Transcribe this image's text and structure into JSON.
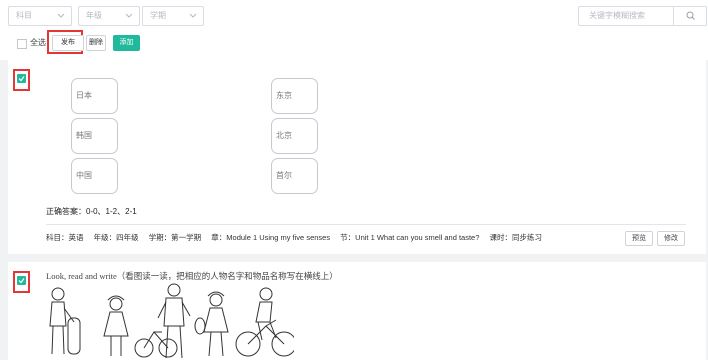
{
  "filters": {
    "subject": "科目",
    "grade": "年级",
    "term": "学期",
    "search_placeholder": "关键字模糊搜索"
  },
  "toolbar": {
    "select_all": "全选",
    "publish": "发布",
    "delete": "删除",
    "add": "添加"
  },
  "question1": {
    "left_options": [
      "日本",
      "韩国",
      "中国"
    ],
    "right_options": [
      "东京",
      "北京",
      "首尔"
    ],
    "answer": "正确答案：0-0、1-2、2-1",
    "meta": {
      "subject": "科目：英语",
      "grade": "年级：四年级",
      "term": "学期：第一学期",
      "chapter": "章：Module 1   Using my five senses",
      "section": "节：Unit 1   What can you smell and taste?",
      "lesson": "课时：同步练习"
    },
    "preview": "预览",
    "edit": "修改"
  },
  "question2": {
    "title": "Look, read and write（看图读一读，把相应的人物名字和物品名称写在横线上）"
  },
  "colors": {
    "accent": "#20b99b",
    "highlight": "#e43636"
  }
}
